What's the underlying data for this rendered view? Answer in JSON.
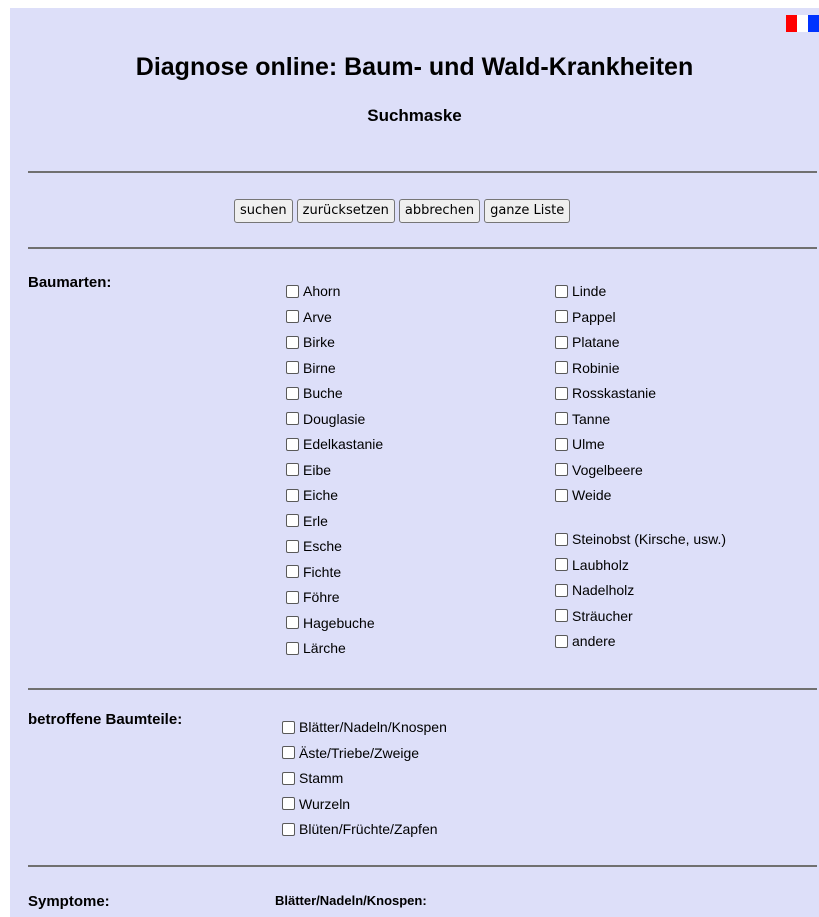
{
  "header": {
    "title": "Diagnose online: Baum- und Wald-Krankheiten",
    "subtitle": "Suchmaske",
    "language_flag": "french-flag-icon"
  },
  "toolbar": {
    "search": "suchen",
    "reset": "zurücksetzen",
    "cancel": "abbrechen",
    "full_list": "ganze Liste"
  },
  "baumarten": {
    "label": "Baumarten:",
    "col1": [
      "Ahorn",
      "Arve",
      "Birke",
      "Birne",
      "Buche",
      "Douglasie",
      "Edelkastanie",
      "Eibe",
      "Eiche",
      "Erle",
      "Esche",
      "Fichte",
      "Föhre",
      "Hagebuche",
      "Lärche"
    ],
    "col2": [
      "Linde",
      "Pappel",
      "Platane",
      "Robinie",
      "Rosskastanie",
      "Tanne",
      "Ulme",
      "Vogelbeere",
      "Weide"
    ],
    "col2_extra": [
      "Steinobst (Kirsche, usw.)",
      "Laubholz",
      "Nadelholz",
      "Sträucher",
      "andere"
    ]
  },
  "baumteile": {
    "label": "betroffene Baumteile:",
    "items": [
      "Blätter/Nadeln/Knospen",
      "Äste/Triebe/Zweige",
      "Stamm",
      "Wurzeln",
      "Blüten/Früchte/Zapfen"
    ]
  },
  "symptome": {
    "label": "Symptome:",
    "sub_label": "Blätter/Nadeln/Knospen:"
  },
  "colors": {
    "background": "#dddff9",
    "divider": "#707070"
  }
}
